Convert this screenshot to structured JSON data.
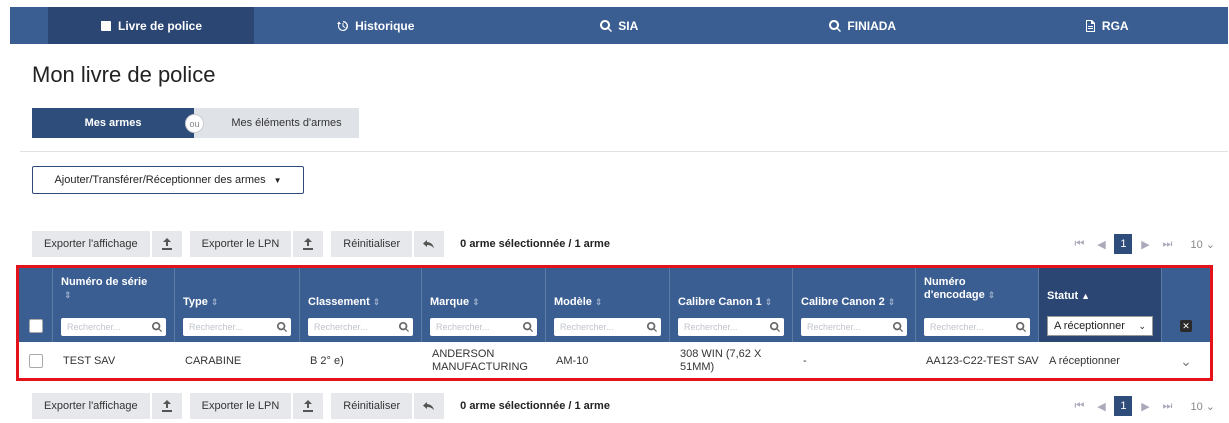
{
  "nav": {
    "tabs": [
      {
        "label": "Livre de police",
        "icon": "book-icon"
      },
      {
        "label": "Historique",
        "icon": "history-icon"
      },
      {
        "label": "SIA",
        "icon": "search-icon"
      },
      {
        "label": "FINIADA",
        "icon": "search-icon"
      },
      {
        "label": "RGA",
        "icon": "document-icon"
      }
    ]
  },
  "page": {
    "title": "Mon livre de police"
  },
  "toggle": {
    "on": "Mes armes",
    "or": "ou",
    "off": "Mes éléments d'armes"
  },
  "add_button": {
    "label": "Ajouter/Transférer/Réceptionner des armes"
  },
  "toolbar": {
    "export_display": "Exporter l'affichage",
    "export_lpn": "Exporter le LPN",
    "reset": "Réinitialiser",
    "selection": "0 arme sélectionnée / 1 arme"
  },
  "pager": {
    "current": "1",
    "page_size": "10"
  },
  "table": {
    "search_placeholder": "Rechercher...",
    "columns": [
      {
        "label": "Numéro de série"
      },
      {
        "label": "Type"
      },
      {
        "label": "Classement"
      },
      {
        "label": "Marque"
      },
      {
        "label": "Modèle"
      },
      {
        "label": "Calibre Canon 1"
      },
      {
        "label": "Calibre Canon 2"
      },
      {
        "label": "Numéro d'encodage"
      },
      {
        "label": "Statut"
      }
    ],
    "status_filter": "A réceptionner",
    "row": {
      "serial": "TEST SAV",
      "type": "CARABINE",
      "classement": "B 2° e)",
      "marque": "ANDERSON MANUFACTURING",
      "modele": "AM-10",
      "calibre1": "308 WIN (7,62 X 51MM)",
      "calibre2": "-",
      "encodage": "AA123-C22-TEST SAV",
      "statut": "A réceptionner"
    }
  },
  "colors": {
    "nav": "#3b5e92",
    "accent": "#2f4d7b",
    "highlight": "#e4121b"
  }
}
